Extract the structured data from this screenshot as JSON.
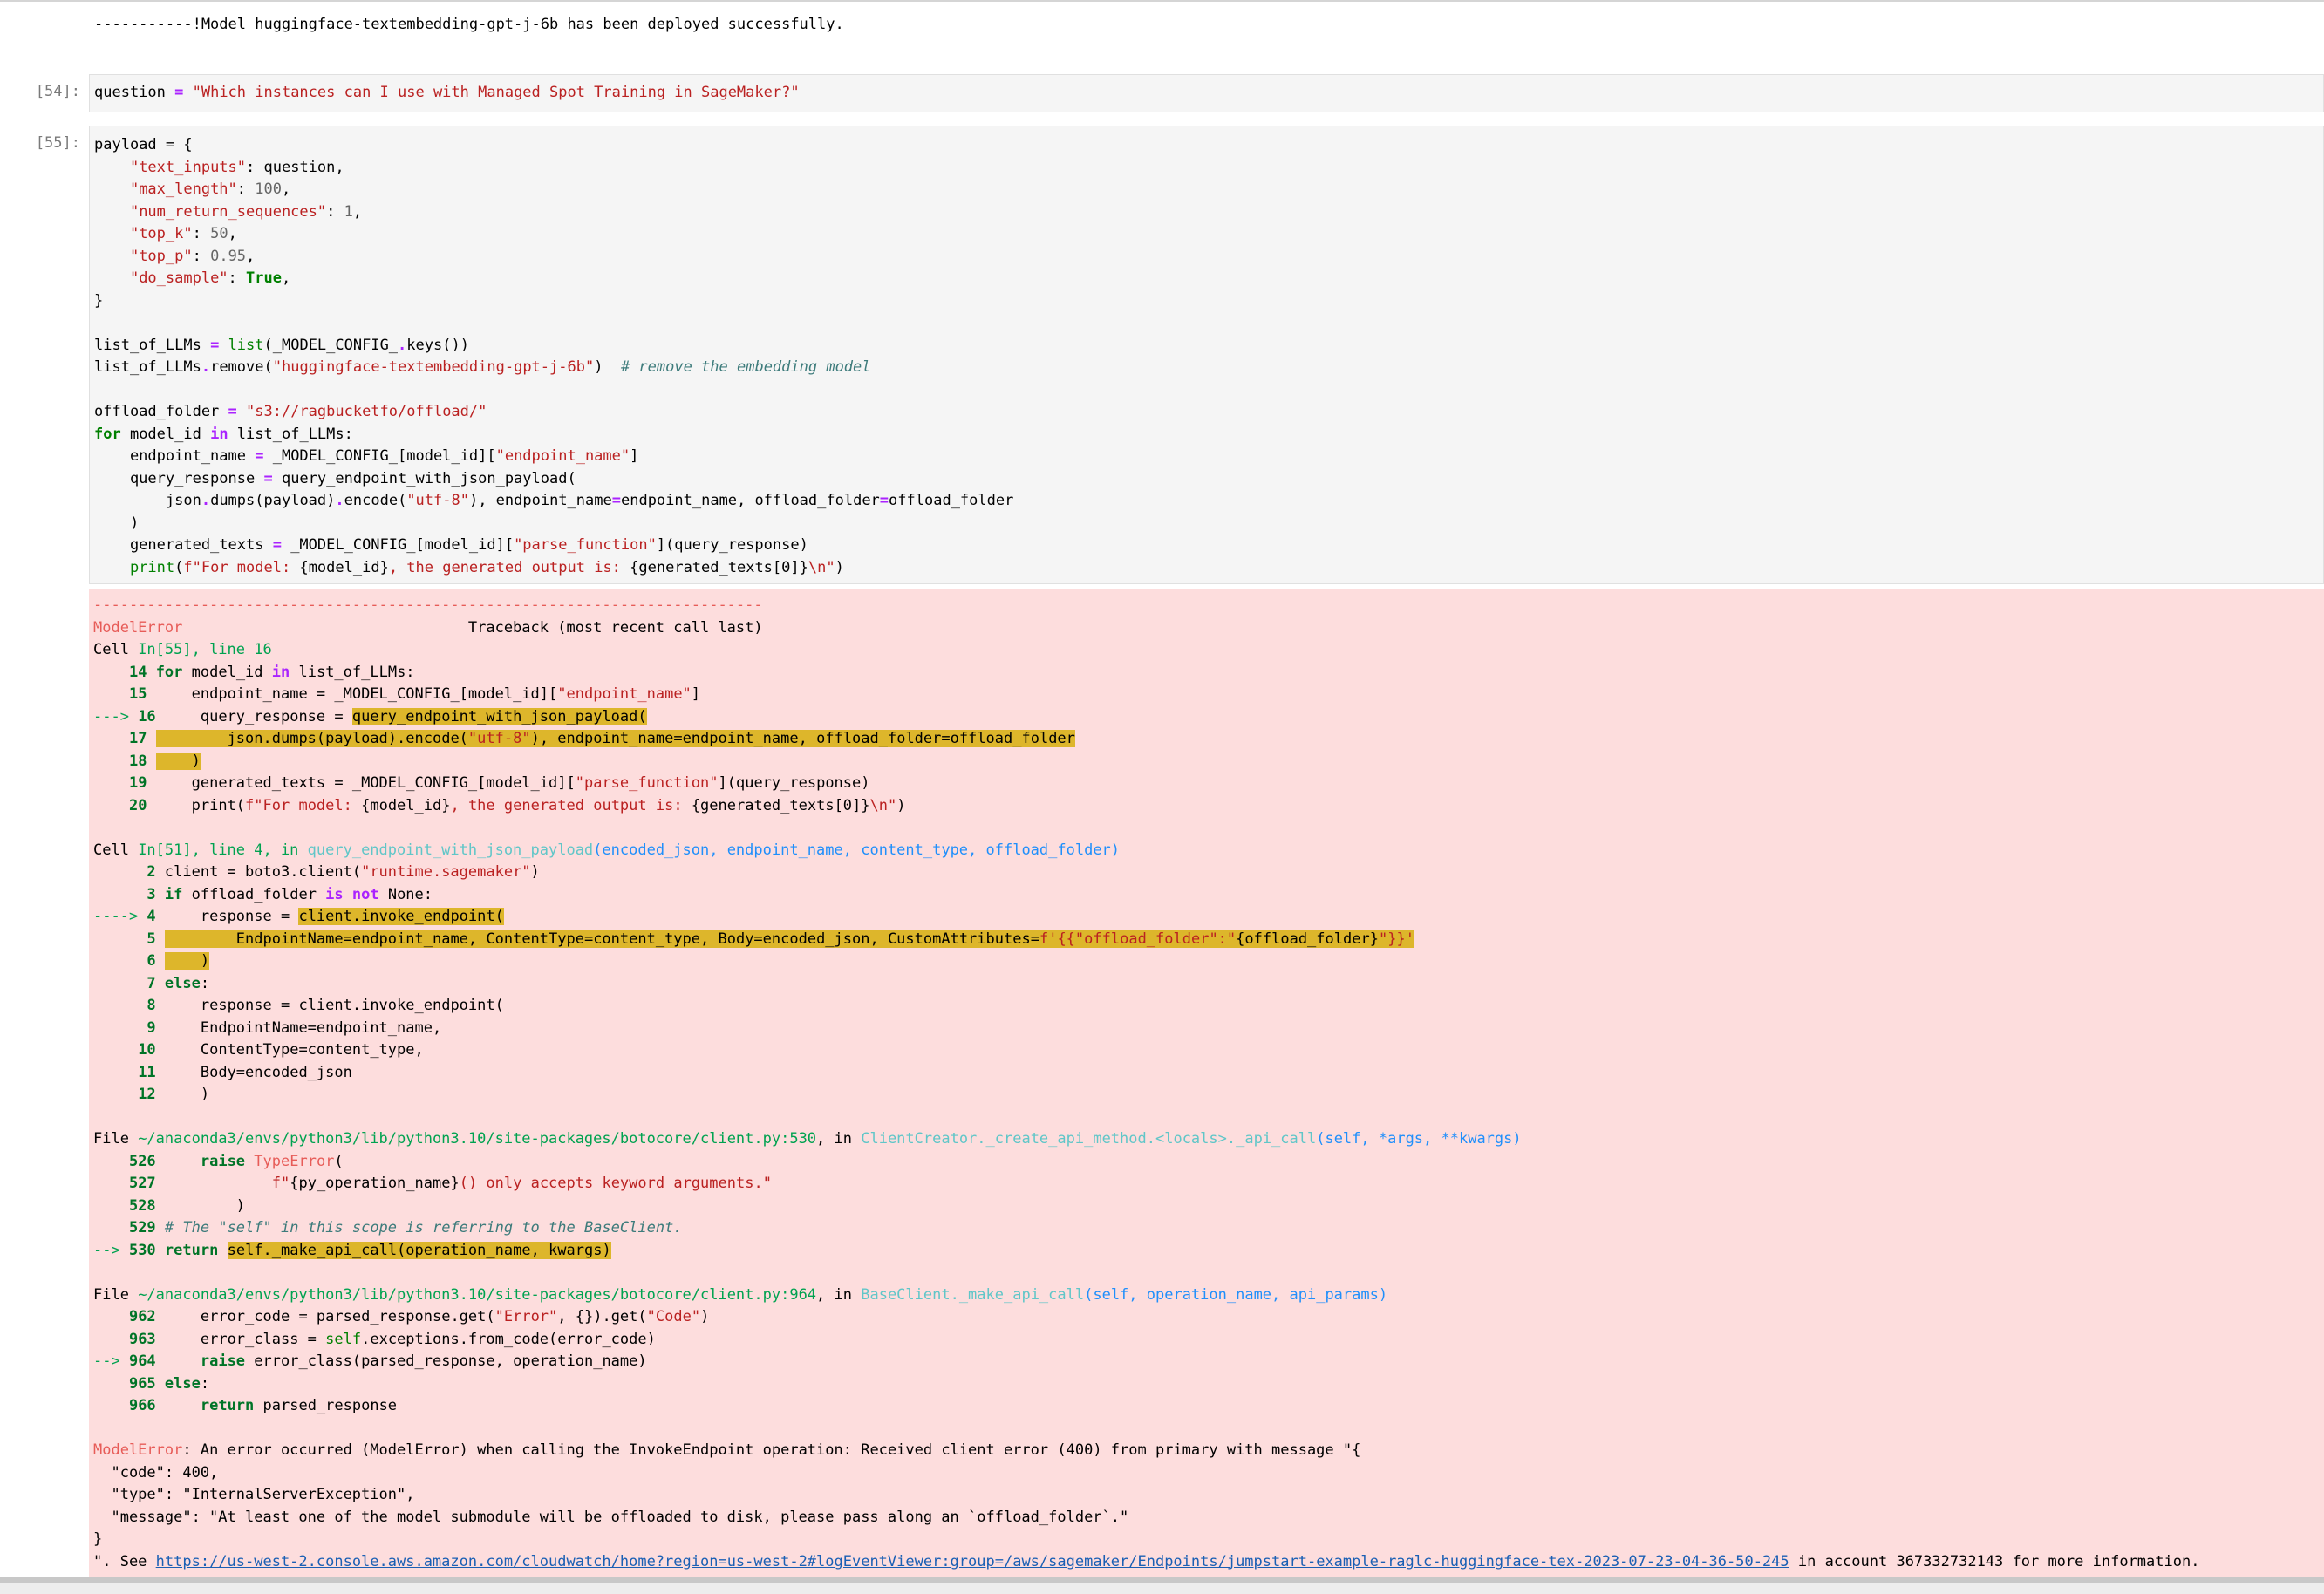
{
  "output_top": "-----------!Model huggingface-textembedding-gpt-j-6b has been deployed successfully.",
  "cell54": {
    "prompt": "[54]:",
    "line": {
      "var": "question",
      "eq": " = ",
      "str": "\"Which instances can I use with Managed Spot Training in SageMaker?\""
    }
  },
  "cell55": {
    "prompt": "[55]:",
    "l1": "payload = {",
    "payload": [
      {
        "k": "\"text_inputs\"",
        "v": "question",
        "vt": "var"
      },
      {
        "k": "\"max_length\"",
        "v": "100",
        "vt": "num"
      },
      {
        "k": "\"num_return_sequences\"",
        "v": "1",
        "vt": "num"
      },
      {
        "k": "\"top_k\"",
        "v": "50",
        "vt": "num"
      },
      {
        "k": "\"top_p\"",
        "v": "0.95",
        "vt": "num"
      },
      {
        "k": "\"do_sample\"",
        "v": "True",
        "vt": "kw"
      }
    ],
    "close": "}",
    "list1": {
      "a": "list_of_LLMs ",
      "eq": "=",
      "b": " ",
      "fn": "list",
      "c": "(_MODEL_CONFIG_",
      "dot": ".",
      "m": "keys",
      "d": "())"
    },
    "list2": {
      "a": "list_of_LLMs",
      "dot": ".",
      "m": "remove",
      "b": "(",
      "s": "\"huggingface-textembedding-gpt-j-6b\"",
      "c": ")  ",
      "cm": "# remove the embedding model"
    },
    "off": {
      "a": "offload_folder ",
      "eq": "=",
      "b": " ",
      "s": "\"s3://ragbucketfo/offload/\""
    },
    "for": {
      "kw": "for",
      "a": " model_id ",
      "in": "in",
      "b": " list_of_LLMs:"
    },
    "ep": {
      "a": "    endpoint_name ",
      "eq": "=",
      "b": " _MODEL_CONFIG_[model_id][",
      "s": "\"endpoint_name\"",
      "c": "]"
    },
    "qr": {
      "a": "    query_response ",
      "eq": "=",
      "b": " query_endpoint_with_json_payload("
    },
    "js": {
      "a": "        json",
      "d1": ".",
      "m1": "dumps",
      "b": "(payload)",
      "d2": ".",
      "m2": "encode",
      "c": "(",
      "s": "\"utf-8\"",
      "d": "), endpoint_name",
      "e1": "=",
      "e": "endpoint_name, offload_folder",
      "e2": "=",
      "f": "offload_folder"
    },
    "cp": "    )",
    "gt": {
      "a": "    generated_texts ",
      "eq": "=",
      "b": " _MODEL_CONFIG_[model_id][",
      "s": "\"parse_function\"",
      "c": "](query_response)"
    },
    "pr": {
      "a": "    ",
      "fn": "print",
      "b": "(",
      "s1": "f\"For model: ",
      "i1": "{model_id}",
      "s2": ", the generated output is: ",
      "i2": "{generated_texts[0]}",
      "s3": "\\n\"",
      "c": ")"
    }
  },
  "tb": {
    "dashes": "---------------------------------------------------------------------------",
    "err_name": "ModelError",
    "traceback_label": "Traceback (most recent call last)",
    "cell1": {
      "label": "Cell ",
      "ref": "In[55], line 16"
    },
    "f1": [
      {
        "mark": "    ",
        "n": "14",
        "kind": "for",
        "a": " model_id ",
        "in": "in",
        "b": " list_of_LLMs:"
      },
      {
        "mark": "    ",
        "n": "15",
        "a": "    endpoint_name = _MODEL_CONFIG_[model_id][",
        "s": "\"endpoint_name\"",
        "c": "]"
      },
      {
        "mark": "---> ",
        "n": "16",
        "a": "    query_response = ",
        "hl": "query_endpoint_with_json_payload("
      },
      {
        "mark": "    ",
        "n": "17",
        "hl1": "        json.dumps(payload).encode(",
        "hls": "\"utf-8\"",
        "hl2": "), endpoint_name=endpoint_name, offload_folder=offload_folder"
      },
      {
        "mark": "    ",
        "n": "18",
        "hl": "    )"
      },
      {
        "mark": "    ",
        "n": "19",
        "a": "    generated_texts = _MODEL_CONFIG_[model_id][",
        "s": "\"parse_function\"",
        "c": "](query_response)"
      },
      {
        "mark": "    ",
        "n": "20",
        "a": "    print(",
        "s": "f\"For model: ",
        "i1": "{model_id}",
        "s2": ", the generated output is: ",
        "i2": "{generated_texts[0]}",
        "s3": "\\n\"",
        "c": ")"
      }
    ],
    "cell2": {
      "label": "Cell ",
      "ref": "In[51], line 4, in ",
      "fn": "query_endpoint_with_json_payload",
      "args": "(encoded_json, endpoint_name, content_type, offload_folder)"
    },
    "f2": {
      "l2": {
        "n": "2",
        "a": " client = boto3.client(",
        "s": "\"runtime.sagemaker\"",
        "c": ")"
      },
      "l3": {
        "n": "3",
        "kw": "if",
        "a": " offload_folder ",
        "isnot": "is not",
        "b": " None:"
      },
      "l4": {
        "mark": "----> ",
        "n": "4",
        "a": "    response = ",
        "hl": "client.invoke_endpoint("
      },
      "l5": {
        "n": "5",
        "hl1": "        EndpointName=endpoint_name, ContentType=content_type, Body=encoded_json, CustomAttributes=",
        "hls1": "f'",
        "hli1": "{{",
        "hls2": "\"offload_folder\":\"",
        "hli2": "{",
        "hlv": "offload_folder",
        "hli3": "}",
        "hls3": "\"",
        "hli4": "}}",
        "hls4": "'"
      },
      "l6": {
        "n": "6",
        "hl": "    )"
      },
      "l7": {
        "n": "7",
        "kw": "else",
        "a": ":"
      },
      "l8": {
        "n": "8",
        "a": "    response = client.invoke_endpoint("
      },
      "l9": {
        "n": "9",
        "a": "    EndpointName=endpoint_name,"
      },
      "l10": {
        "n": "10",
        "a": "    ContentType=content_type,"
      },
      "l11": {
        "n": "11",
        "a": "    Body=encoded_json"
      },
      "l12": {
        "n": "12",
        "a": "    )"
      }
    },
    "file1": {
      "label": "File ",
      "path": "~/anaconda3/envs/python3/lib/python3.10/site-packages/botocore/client.py:530",
      "in": ", in ",
      "fn": "ClientCreator._create_api_method.<locals>._api_call",
      "args": "(self, *args, **kwargs)"
    },
    "f3": {
      "l526": {
        "n": "526",
        "kw": "raise",
        "a": " ",
        "err": "TypeError",
        "b": "("
      },
      "l527": {
        "n": "527",
        "a": "        ",
        "s": "f\"",
        "i": "{py_operation_name}",
        "s2": "() only accepts keyword arguments.\""
      },
      "l528": {
        "n": "528",
        "a": "    )"
      },
      "l529": {
        "n": "529",
        "a": " ",
        "cm": "# The \"self\" in this scope is referring to the BaseClient."
      },
      "l530": {
        "mark": "--> ",
        "n": "530",
        "kw": "return",
        "a": " ",
        "hl": "self._make_api_call(operation_name, kwargs)"
      }
    },
    "file2": {
      "label": "File ",
      "path": "~/anaconda3/envs/python3/lib/python3.10/site-packages/botocore/client.py:964",
      "in": ", in ",
      "fn": "BaseClient._make_api_call",
      "args": "(self, operation_name, api_params)"
    },
    "f4": {
      "l962": {
        "n": "962",
        "a": "    error_code = parsed_response.get(",
        "s1": "\"Error\"",
        "b": ", {}).get(",
        "s2": "\"Code\"",
        "c": ")"
      },
      "l963": {
        "n": "963",
        "a": "    error_class = ",
        "self": "self",
        "b": ".exceptions.from_code(error_code)"
      },
      "l964": {
        "mark": "--> ",
        "n": "964",
        "kw": "raise",
        "a": " error_class(parsed_response, operation_name)"
      },
      "l965": {
        "n": "965",
        "kw": "else",
        "a": ":"
      },
      "l966": {
        "n": "966",
        "kw": "return",
        "a": " parsed_response"
      }
    },
    "final": {
      "err": "ModelError",
      "msg": ": An error occurred (ModelError) when calling the InvokeEndpoint operation: Received client error (400) from primary with message \"{",
      "j1": "  \"code\": 400,",
      "j2": "  \"type\": \"InternalServerException\",",
      "j3": "  \"message\": \"At least one of the model submodule will be offloaded to disk, please pass along an `offload_folder`.\"",
      "j4": "}",
      "see": "\". See ",
      "url": "https://us-west-2.console.aws.amazon.com/cloudwatch/home?region=us-west-2#logEventViewer:group=/aws/sagemaker/Endpoints/jumpstart-example-raglc-huggingface-tex-2023-07-23-04-36-50-245",
      "after": " in account 367332732143 for more information."
    }
  }
}
